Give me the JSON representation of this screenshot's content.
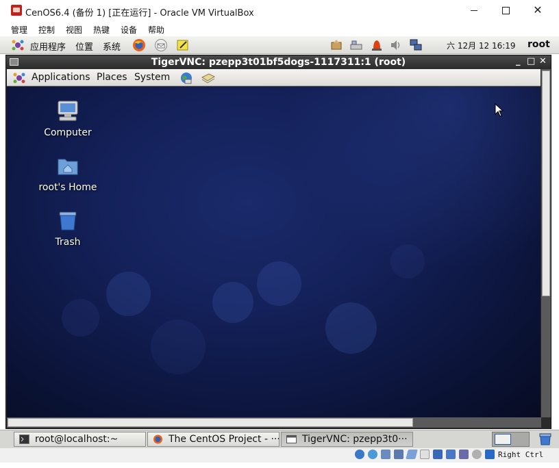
{
  "window": {
    "title": "CenOS6.4 (备份 1) [正在运行] - Oracle VM VirtualBox",
    "minimize_icon": "minimize-icon",
    "maximize_icon": "maximize-icon",
    "close_glyph": "✕"
  },
  "vbox_menu": [
    "管理",
    "控制",
    "视图",
    "热键",
    "设备",
    "帮助"
  ],
  "guest_panel": {
    "menus": [
      "应用程序",
      "位置",
      "系统"
    ],
    "clock": "六 12月 12 16:19",
    "user": "root"
  },
  "vnc_window": {
    "title": "TigerVNC: pzepp3t01bf5dogs-1117311:1 (root)",
    "minimize": "_",
    "maximize": "□",
    "close": "✕",
    "menus": [
      "Applications",
      "Places",
      "System"
    ]
  },
  "desktop_icons": [
    {
      "label": "Computer",
      "icon": "computer-icon"
    },
    {
      "label": "root's Home",
      "icon": "home-folder-icon"
    },
    {
      "label": "Trash",
      "icon": "trash-icon"
    }
  ],
  "taskbar": [
    {
      "label": "root@localhost:~",
      "icon": "terminal-icon"
    },
    {
      "label": "The CentOS Project - ···",
      "icon": "firefox-icon"
    },
    {
      "label": "TigerVNC: pzepp3t0···",
      "icon": "vnc-window-icon"
    }
  ],
  "statusbar": {
    "host_key": "Right Ctrl"
  },
  "colors": {
    "desktop_bg": "#14215a",
    "vnc_title_bg": "#2b2b2b",
    "panel_bg": "#dcdcd8"
  }
}
